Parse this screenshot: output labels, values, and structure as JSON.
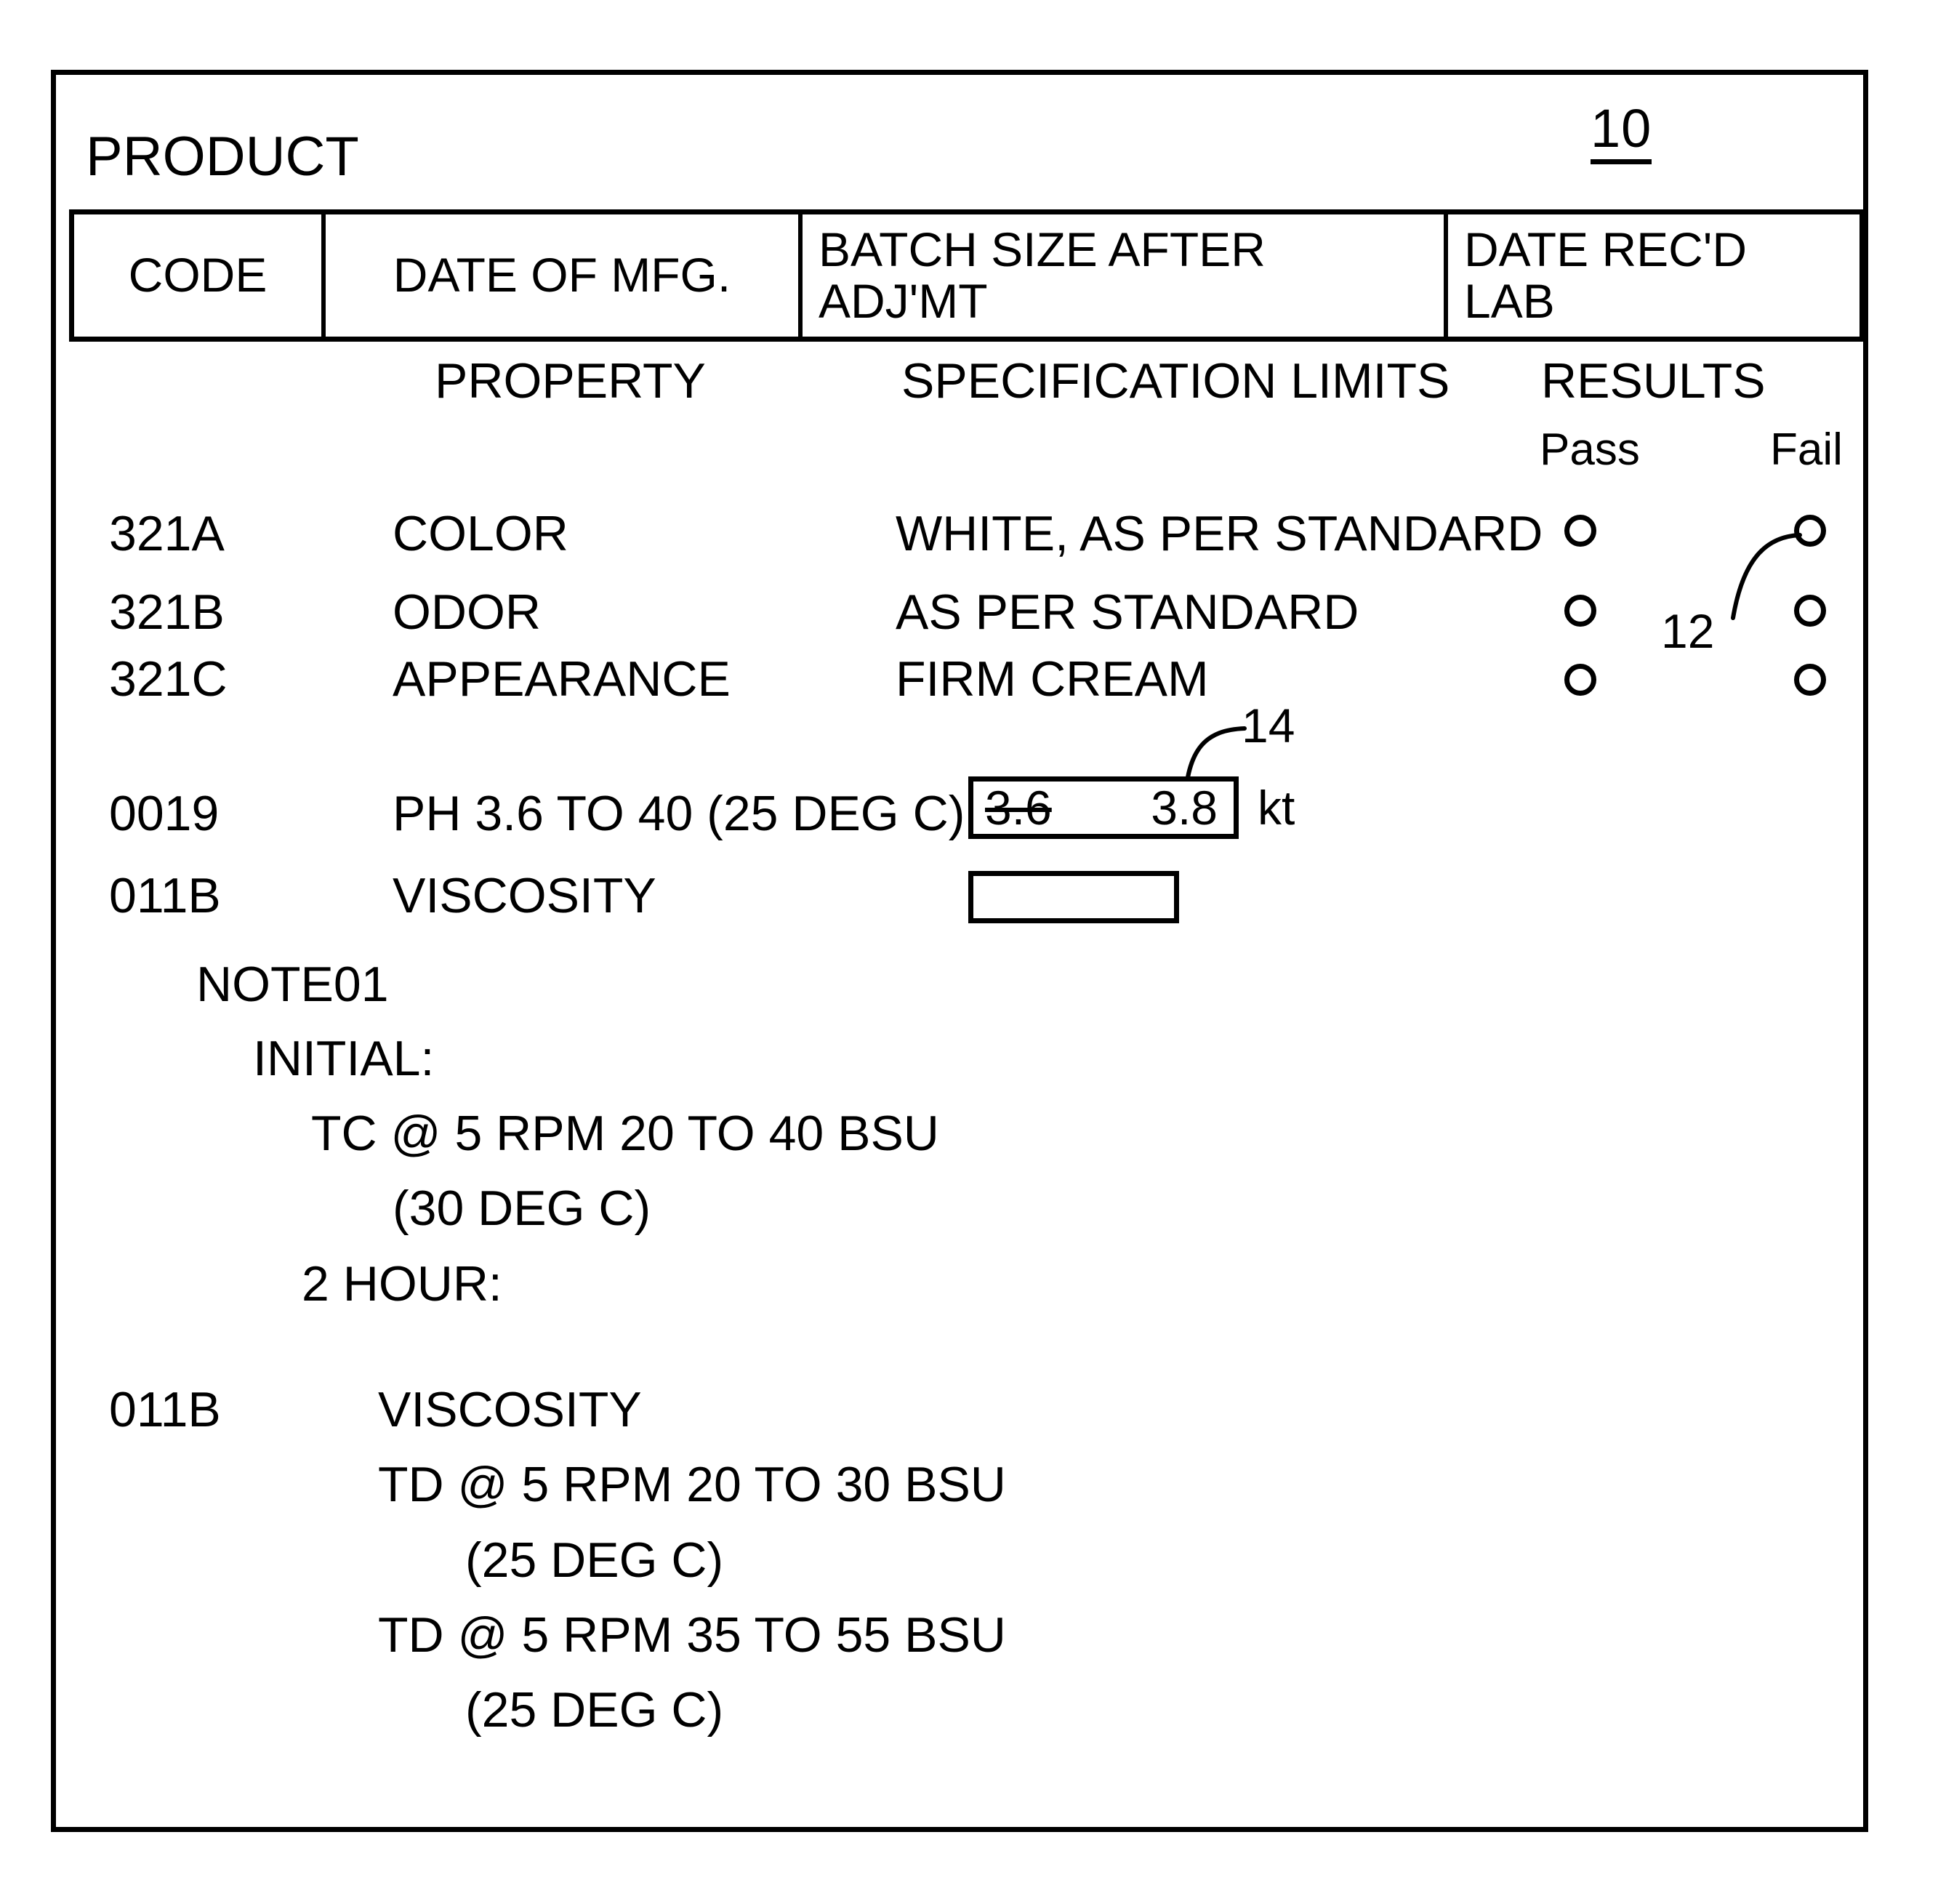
{
  "figure": {
    "reference_numerals": {
      "form": "10",
      "results_checkboxes": "12",
      "editable_value_field": "14"
    }
  },
  "form": {
    "title": "PRODUCT",
    "header_row": [
      {
        "label": "CODE"
      },
      {
        "label": "DATE OF MFG."
      },
      {
        "label_line1": "BATCH SIZE AFTER",
        "label_line2": "ADJ'MT"
      },
      {
        "label_line1": "DATE REC'D",
        "label_line2": "LAB"
      }
    ],
    "column_headers": {
      "property": "PROPERTY",
      "specification_limits": "SPECIFICATION LIMITS",
      "results": "RESULTS",
      "pass": "Pass",
      "fail": "Fail"
    },
    "test_rows": [
      {
        "code": "321A",
        "property": "COLOR",
        "spec": "WHITE, AS PER STANDARD",
        "pass_checked": false,
        "fail_checked": false
      },
      {
        "code": "321B",
        "property": "ODOR",
        "spec": "AS PER STANDARD",
        "pass_checked": false,
        "fail_checked": false
      },
      {
        "code": "321C",
        "property": "APPEARANCE",
        "spec": "FIRM CREAM",
        "pass_checked": false,
        "fail_checked": false
      }
    ],
    "ph_row": {
      "code": "0019",
      "property": "PH 3.6 TO 40 (25 DEG C)",
      "old_value": "3.6",
      "new_value": "3.8",
      "unit": "kt"
    },
    "viscosity_row_1": {
      "code": "011B",
      "property": "VISCOSITY",
      "value": ""
    },
    "note_block": {
      "note_id": "NOTE01",
      "initial_label": "INITIAL:",
      "initial_spec": "TC @ 5 RPM 20 TO 40 BSU",
      "initial_temp": "(30 DEG C)",
      "two_hour_label": "2 HOUR:"
    },
    "viscosity_row_2": {
      "code": "011B",
      "property": "VISCOSITY",
      "spec_line1": "TD @ 5 RPM 20 TO 30 BSU",
      "temp_line1": "(25 DEG C)",
      "spec_line2": "TD @ 5 RPM 35 TO 55 BSU",
      "temp_line2": "(25 DEG C)"
    }
  },
  "colors": {
    "ink": "#000000",
    "paper": "#ffffff"
  }
}
